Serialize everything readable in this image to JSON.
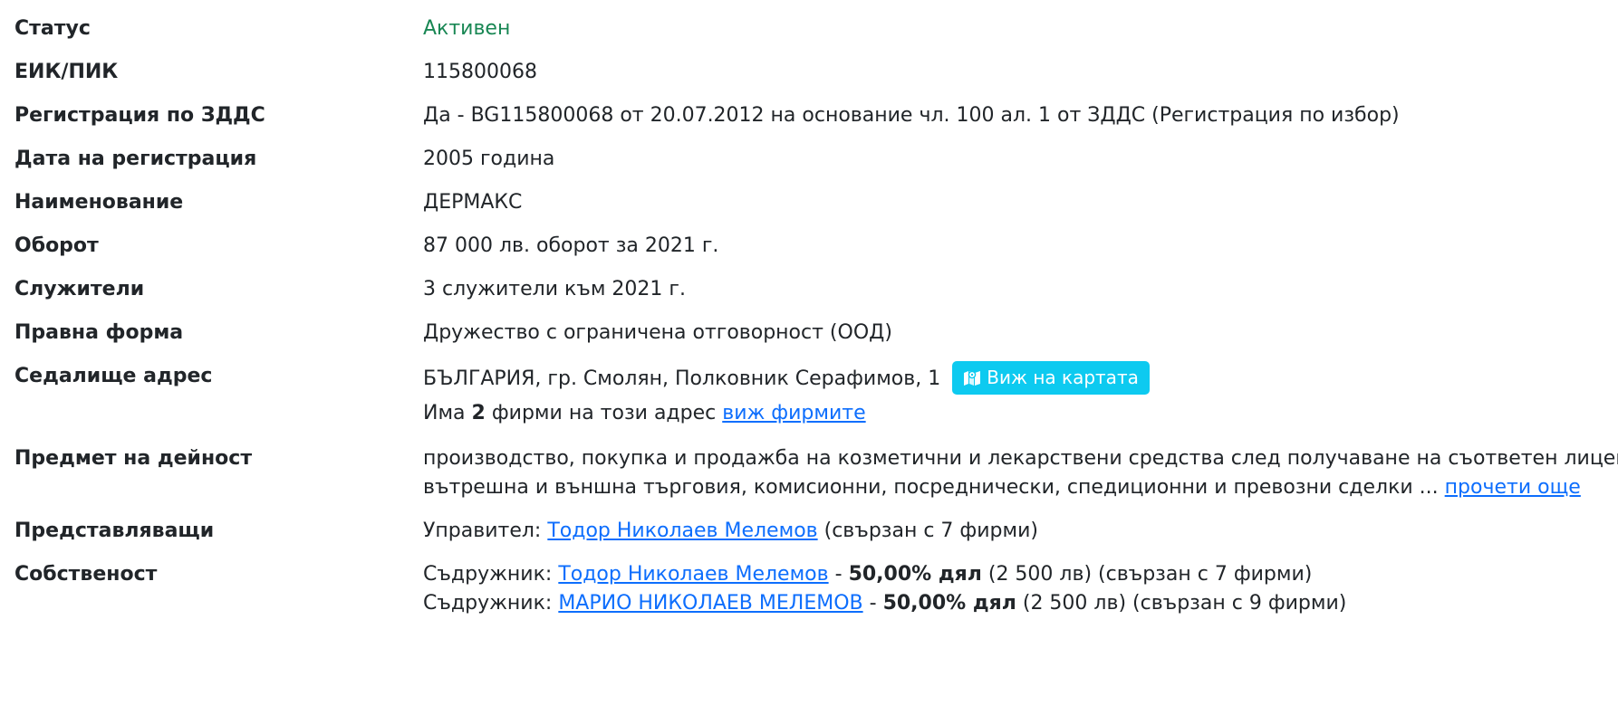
{
  "rows": {
    "status": {
      "label": "Статус",
      "value": "Активен"
    },
    "eik": {
      "label": "ЕИК/ПИК",
      "value": "115800068"
    },
    "vat": {
      "label": "Регистрация по ЗДДС",
      "value": "Да - BG115800068 от 20.07.2012 на основание чл. 100 ал. 1 от ЗДДС (Регистрация по избор)"
    },
    "reg_date": {
      "label": "Дата на регистрация",
      "value": "2005 година"
    },
    "name": {
      "label": "Наименование",
      "value": "ДЕРМАКС"
    },
    "turnover": {
      "label": "Оборот",
      "value": "87 000 лв. оборот за 2021 г."
    },
    "employees": {
      "label": "Служители",
      "value": "3 служители към 2021 г."
    },
    "legal_form": {
      "label": "Правна форма",
      "value": "Дружество с ограничена отговорност (ООД)"
    },
    "address": {
      "label": "Седалище адрес",
      "value": "БЪЛГАРИЯ, гр. Смолян, Полковник Серафимов, 1",
      "map_button": "Виж на картата",
      "map_icon": "map-icon",
      "firms_prefix": "Има",
      "firms_count": "2",
      "firms_middle": "фирми на този адрес",
      "firms_link": "виж фирмите"
    },
    "activity": {
      "label": "Предмет на дейност",
      "line1": "производство, покупка и продажба на козметични и лекарствени средства след получаване на съответен лиценз;",
      "line2": "вътрешна и външна търговия, комисионни, посреднически, спедиционни и превозни сделки ...",
      "more_link": "прочети още"
    },
    "representatives": {
      "label": "Представляващи",
      "role": "Управител:",
      "person": "Тодор Николаев Мелемов",
      "suffix": "(свързан с 7 фирми)"
    },
    "ownership": {
      "label": "Собственост",
      "partners": [
        {
          "role": "Съдружник:",
          "person": "Тодор Николаев Мелемов",
          "sep": "-",
          "share": "50,00% дял",
          "amount": "(2 500 лв)",
          "suffix": "(свързан с 7 фирми)"
        },
        {
          "role": "Съдружник:",
          "person": "МАРИО НИКОЛАЕВ МЕЛЕМОВ",
          "sep": "-",
          "share": "50,00% дял",
          "amount": "(2 500 лв)",
          "suffix": "(свързан с 9 фирми)"
        }
      ]
    }
  },
  "colors": {
    "status_active": "#198754",
    "link": "#0d6efd",
    "map_button_bg": "#0dcaf0"
  }
}
